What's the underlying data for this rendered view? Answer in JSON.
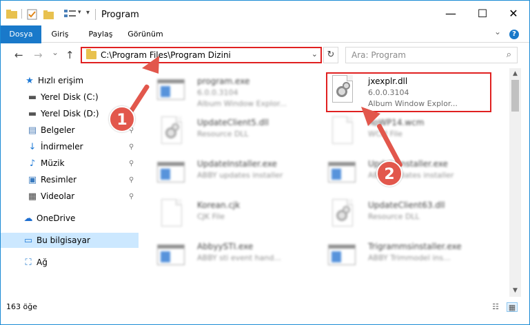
{
  "window": {
    "title": "Program",
    "controls": {
      "minimize": "—",
      "maximize": "☐",
      "close": "✕"
    }
  },
  "ribbon": {
    "tabs": [
      "Dosya",
      "Giriş",
      "Paylaş",
      "Görünüm"
    ],
    "expand_glyph": "⌄",
    "help_glyph": "?"
  },
  "navigation": {
    "back_glyph": "←",
    "forward_glyph": "→",
    "recent_glyph": "⌄",
    "up_glyph": "↑",
    "address": "C:\\Program Files\\Program Dizini",
    "address_dropdown_glyph": "⌄",
    "refresh_glyph": "↻",
    "search_placeholder": "Ara: Program",
    "search_glyph": "⌕"
  },
  "sidebar": {
    "items": [
      {
        "label": "Hızlı erişim",
        "icon": "star-icon",
        "glyph": "★",
        "color": "#1f7ad6",
        "pinned": false
      },
      {
        "label": "Yerel Disk (C:)",
        "icon": "drive-icon",
        "glyph": "▬",
        "color": "#555555",
        "pinned": false
      },
      {
        "label": "Yerel Disk (D:)",
        "icon": "drive-icon",
        "glyph": "▬",
        "color": "#555555",
        "pinned": false
      },
      {
        "label": "Belgeler",
        "icon": "documents-icon",
        "glyph": "▤",
        "color": "#4f7fb8",
        "pinned": true
      },
      {
        "label": "İndirmeler",
        "icon": "download-icon",
        "glyph": "↓",
        "color": "#1f7ad6",
        "pinned": true
      },
      {
        "label": "Müzik",
        "icon": "music-icon",
        "glyph": "♪",
        "color": "#1f7ad6",
        "pinned": true
      },
      {
        "label": "Resimler",
        "icon": "pictures-icon",
        "glyph": "▣",
        "color": "#3a7bbf",
        "pinned": true
      },
      {
        "label": "Videolar",
        "icon": "video-icon",
        "glyph": "▦",
        "color": "#444444",
        "pinned": true
      },
      {
        "label": "OneDrive",
        "icon": "cloud-icon",
        "glyph": "☁",
        "color": "#1f6fd0",
        "pinned": false
      },
      {
        "label": "Bu bilgisayar",
        "icon": "computer-icon",
        "glyph": "▭",
        "color": "#1f7ad6",
        "pinned": false,
        "selected": true
      },
      {
        "label": "Ağ",
        "icon": "network-icon",
        "glyph": "⛶",
        "color": "#2a7fd0",
        "pinned": false
      }
    ],
    "pin_glyph": "⚲"
  },
  "files": [
    {
      "name": "program.exe",
      "meta": "6.0.0.3104",
      "meta2": "Album Window Explor...",
      "icon": "app-icon",
      "blurred": true
    },
    {
      "name": "jxexplr.dll",
      "meta": "6.0.0.3104",
      "meta2": "Album Window Explor...",
      "icon": "dll-icon",
      "blurred": false,
      "selected": true
    },
    {
      "name": "UpdateClient5.dll",
      "meta": "Resource DLL",
      "meta2": "",
      "icon": "dll-icon",
      "blurred": true
    },
    {
      "name": "RoWP14.wcm",
      "meta": "WCM File",
      "meta2": "",
      "icon": "doc-icon",
      "blurred": true
    },
    {
      "name": "UpdateInstaller.exe",
      "meta": "ABBY updates installer",
      "meta2": "",
      "icon": "app-icon",
      "blurred": true
    },
    {
      "name": "UpdateInstaller.exe",
      "meta": "ABBY updates installer",
      "meta2": "",
      "icon": "app-icon",
      "blurred": true
    },
    {
      "name": "Korean.cjk",
      "meta": "CJK File",
      "meta2": "",
      "icon": "doc-icon",
      "blurred": true
    },
    {
      "name": "UpdateClient63.dll",
      "meta": "Resource DLL",
      "meta2": "",
      "icon": "dll-icon",
      "blurred": true
    },
    {
      "name": "AbbyySTI.exe",
      "meta": "ABBY sti event hand...",
      "meta2": "",
      "icon": "app-icon",
      "blurred": true
    },
    {
      "name": "Trigrammsinstaller.exe",
      "meta": "ABBY Trimmodel ins...",
      "meta2": "",
      "icon": "app-icon",
      "blurred": true
    }
  ],
  "annotations": [
    {
      "label": "1",
      "color": "#e2574c"
    },
    {
      "label": "2",
      "color": "#e2574c"
    }
  ],
  "status": {
    "count": "163 öğe",
    "details_view_glyph": "☷",
    "large_icons_glyph": "▦"
  },
  "colors": {
    "accent": "#1979ca",
    "highlight": "#e02020",
    "selection": "#cce8ff"
  }
}
